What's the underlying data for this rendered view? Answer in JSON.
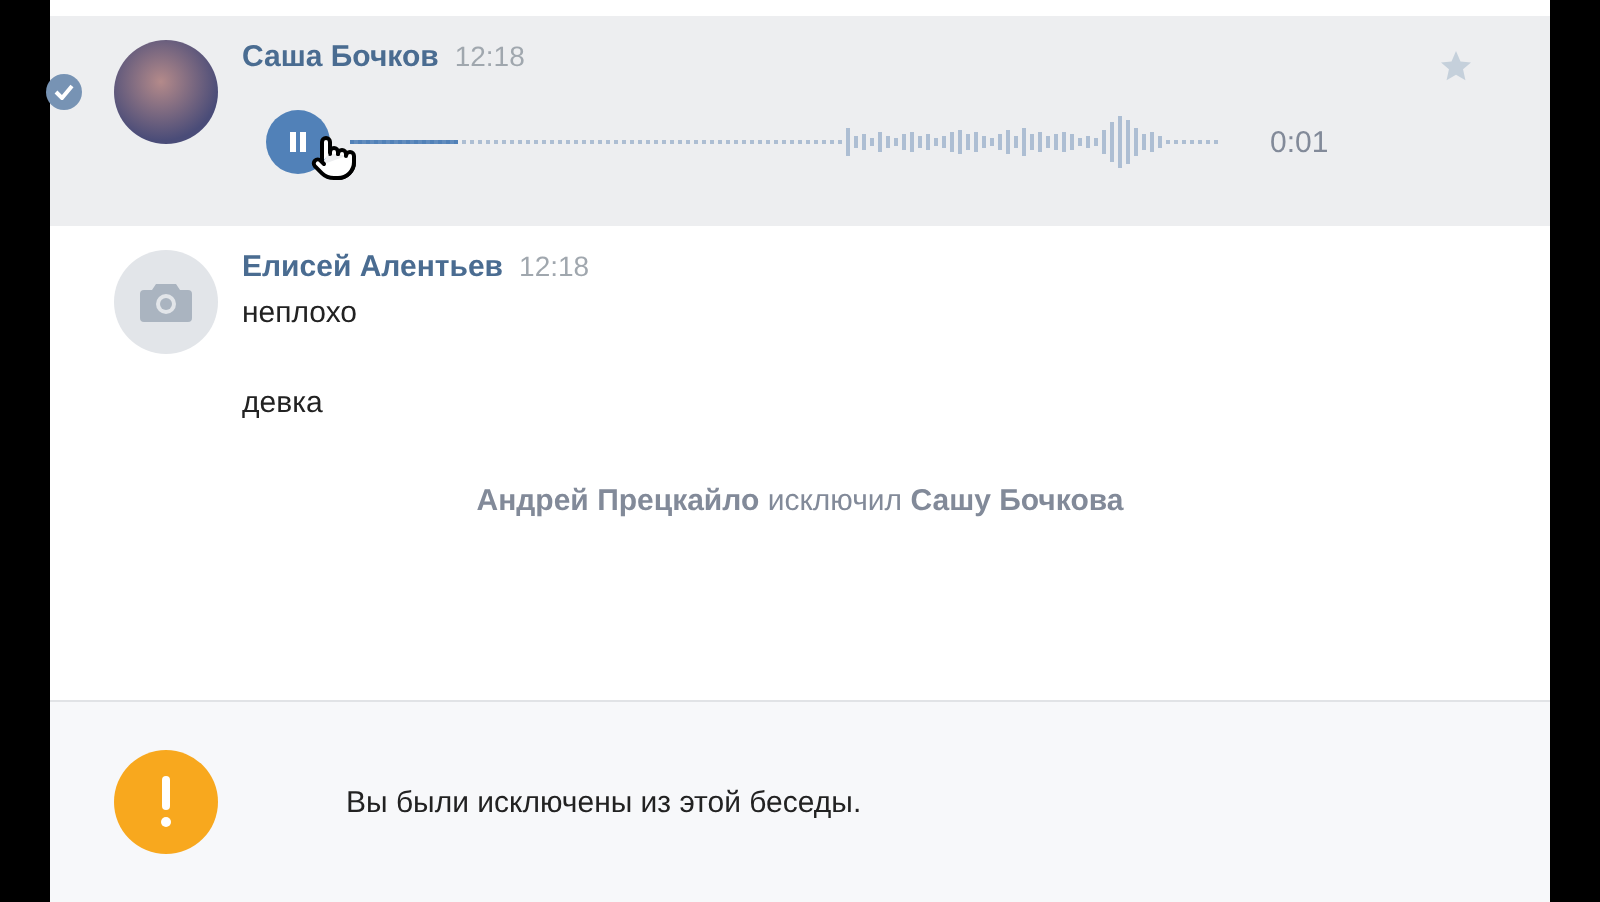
{
  "messages": [
    {
      "kind": "voice",
      "author": "Саша Бочков",
      "time": "12:18",
      "selected": true,
      "starred": false,
      "avatar_photo": true,
      "playing": true,
      "level": 0.12,
      "duration": "0:01"
    },
    {
      "kind": "text",
      "author": "Елисей Алентьев",
      "time": "12:18",
      "selected": false,
      "avatar_photo": false,
      "lines": [
        "неплохо",
        "девка"
      ]
    },
    {
      "kind": "service",
      "text": "**Андрей Прецкайло** исключил **Сашу Бочкова**"
    }
  ],
  "notice": {
    "text": "Вы были исключены из этой беседы."
  }
}
